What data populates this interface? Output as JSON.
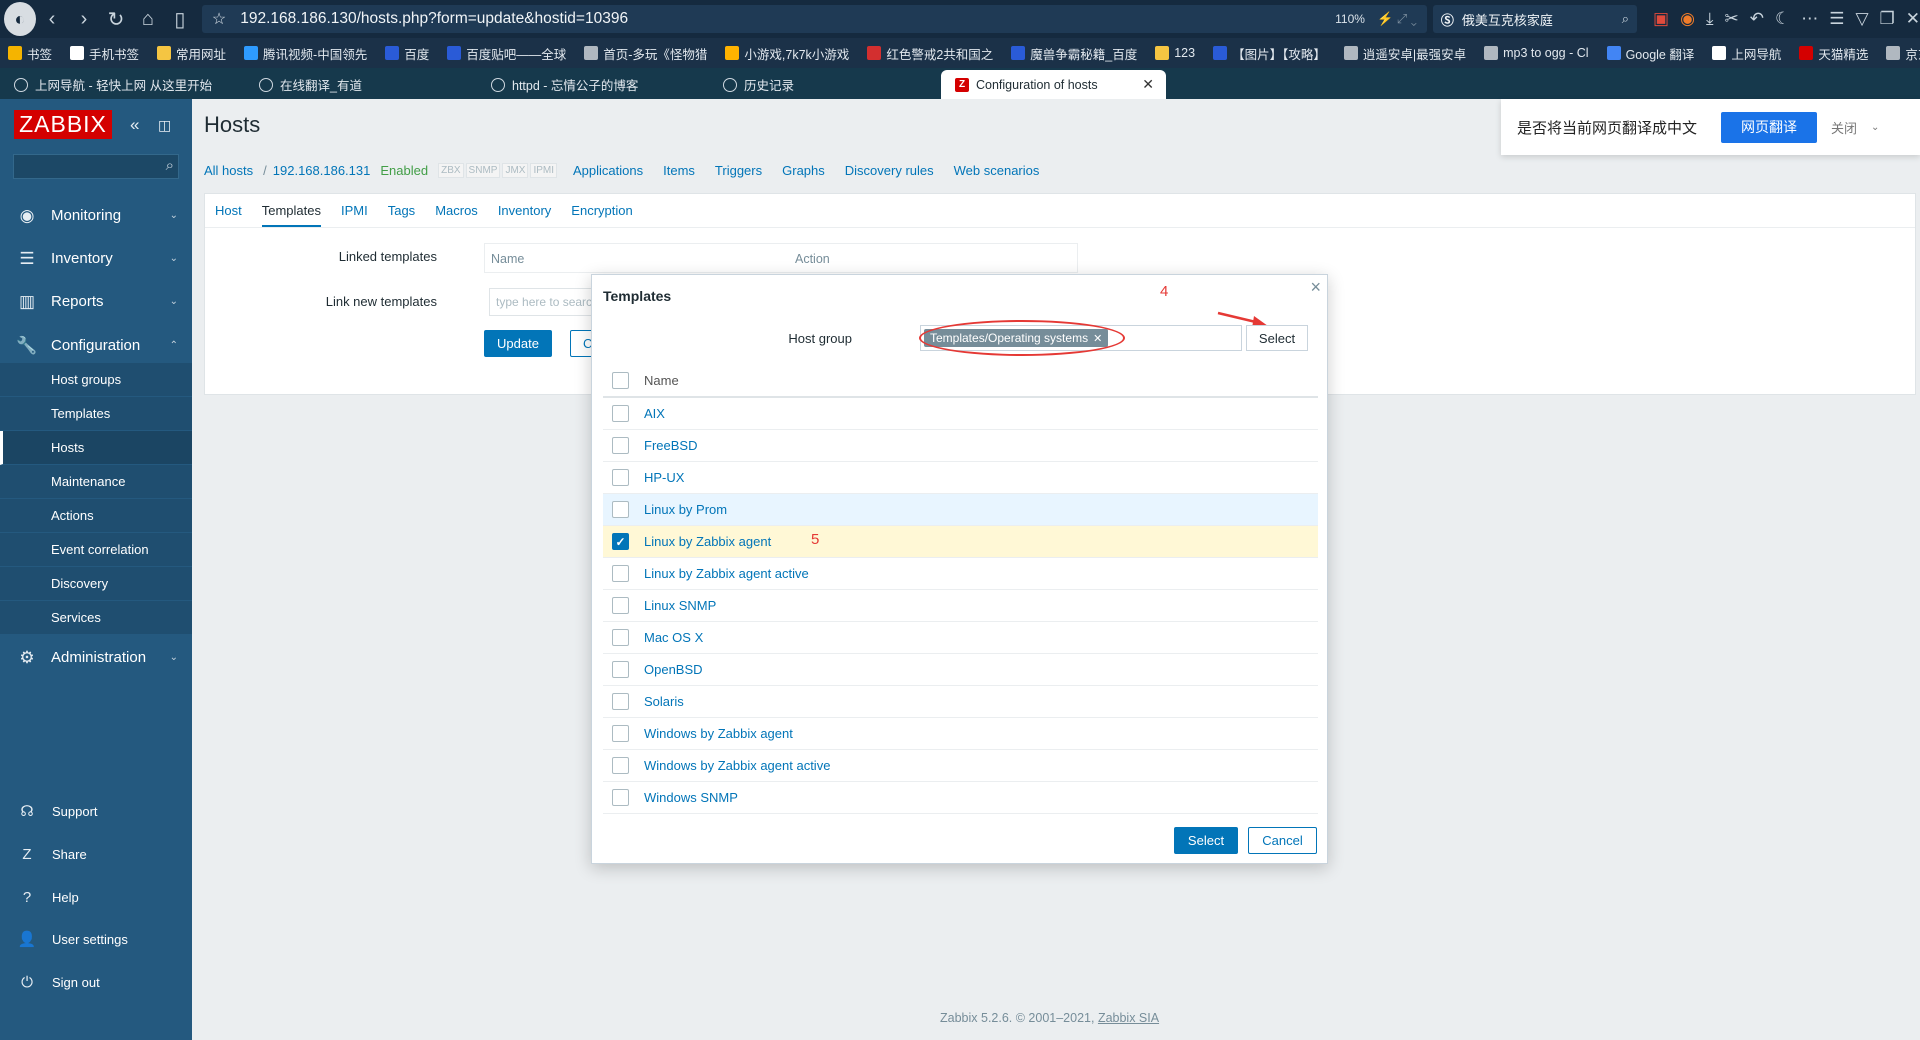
{
  "browser": {
    "url": "192.168.186.130/hosts.php?form=update&hostid=10396",
    "zoom": "110%",
    "search_engine": "俄美互克核家庭",
    "bookmarks": [
      "书签",
      "手机书签",
      "常用网址",
      "腾讯视频-中国领先",
      "百度",
      "百度贴吧——全球",
      "首页-多玩《怪物猎",
      "小游戏,7k7k小游戏",
      "红色警戒2共和国之",
      "魔兽争霸秘籍_百度",
      "123",
      "【图片】【攻略】",
      "逍遥安卓|最强安卓",
      "mp3 to ogg - Cl",
      "Google 翻译",
      "上网导航",
      "天猫精选",
      "京东商城"
    ],
    "tabs": [
      {
        "label": "上网导航 - 轻快上网 从这里开始"
      },
      {
        "label": "在线翻译_有道"
      },
      {
        "label": "httpd - 忘情公子的博客"
      },
      {
        "label": "历史记录"
      },
      {
        "label": "Configuration of hosts"
      }
    ]
  },
  "translate_bar": {
    "text": "是否将当前网页翻译成中文",
    "button": "网页翻译",
    "close": "关闭"
  },
  "sidebar": {
    "logo": "ZABBIX",
    "menu": [
      {
        "label": "Monitoring",
        "icon": "eye-icon"
      },
      {
        "label": "Inventory",
        "icon": "list-icon"
      },
      {
        "label": "Reports",
        "icon": "bar-chart-icon"
      },
      {
        "label": "Configuration",
        "icon": "wrench-icon"
      },
      {
        "label": "Administration",
        "icon": "gear-icon"
      }
    ],
    "submenu": [
      "Host groups",
      "Templates",
      "Hosts",
      "Maintenance",
      "Actions",
      "Event correlation",
      "Discovery",
      "Services"
    ],
    "footer": [
      "Support",
      "Share",
      "Help",
      "User settings",
      "Sign out"
    ]
  },
  "page": {
    "title": "Hosts",
    "breadcrumb": {
      "all_hosts": "All hosts",
      "separator": "/",
      "host": "192.168.186.131",
      "status": "Enabled"
    },
    "availability": [
      "ZBX",
      "SNMP",
      "JMX",
      "IPMI"
    ],
    "host_links": [
      "Applications",
      "Items",
      "Triggers",
      "Graphs",
      "Discovery rules",
      "Web scenarios"
    ],
    "form_tabs": [
      "Host",
      "Templates",
      "IPMI",
      "Tags",
      "Macros",
      "Inventory",
      "Encryption"
    ],
    "linked_templates_label": "Linked templates",
    "linked_cols": {
      "name": "Name",
      "action": "Action"
    },
    "link_new_label": "Link new templates",
    "link_new_placeholder": "type here to search",
    "update_btn": "Update",
    "clone_btn": "Clone"
  },
  "modal": {
    "title": "Templates",
    "host_group_label": "Host group",
    "host_group_value": "Templates/Operating systems",
    "select_btn": "Select",
    "name_header": "Name",
    "templates": [
      {
        "name": "AIX",
        "checked": false
      },
      {
        "name": "FreeBSD",
        "checked": false
      },
      {
        "name": "HP-UX",
        "checked": false
      },
      {
        "name": "Linux by Prom",
        "checked": false
      },
      {
        "name": "Linux by Zabbix agent",
        "checked": true
      },
      {
        "name": "Linux by Zabbix agent active",
        "checked": false
      },
      {
        "name": "Linux SNMP",
        "checked": false
      },
      {
        "name": "Mac OS X",
        "checked": false
      },
      {
        "name": "OpenBSD",
        "checked": false
      },
      {
        "name": "Solaris",
        "checked": false
      },
      {
        "name": "Windows by Zabbix agent",
        "checked": false
      },
      {
        "name": "Windows by Zabbix agent active",
        "checked": false
      },
      {
        "name": "Windows SNMP",
        "checked": false
      }
    ],
    "footer_select": "Select",
    "footer_cancel": "Cancel",
    "annotation_4": "4",
    "annotation_5": "5"
  },
  "footer": {
    "text": "Zabbix 5.2.6. © 2001–2021, ",
    "link": "Zabbix SIA"
  }
}
